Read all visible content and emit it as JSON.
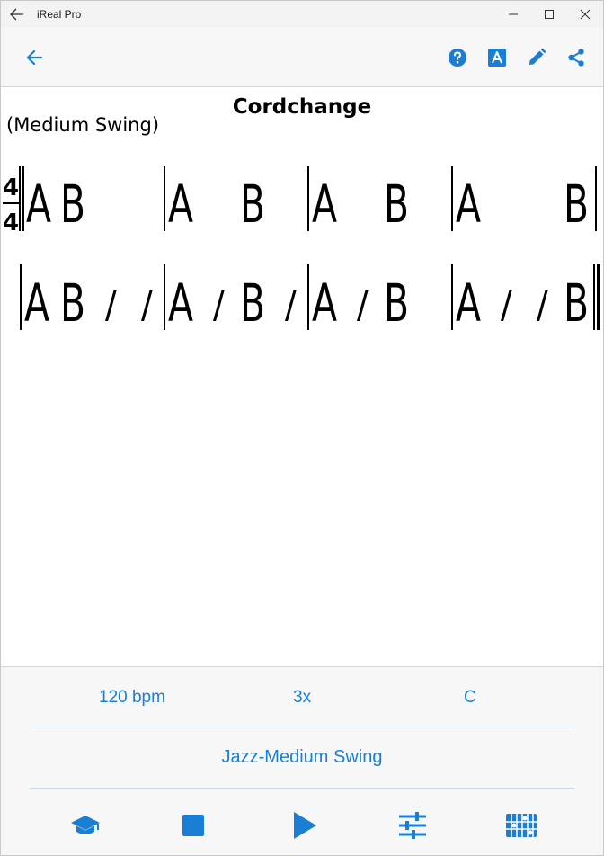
{
  "window": {
    "title": "iReal Pro"
  },
  "song": {
    "title": "Cordchange",
    "style": "(Medium Swing)",
    "time_signature": {
      "top": "4",
      "bottom": "4"
    },
    "chord_a": "A",
    "chord_b": "B",
    "slash": "/"
  },
  "player": {
    "tempo": "120 bpm",
    "repeats": "3x",
    "key": "C",
    "style_preset": "Jazz-Medium Swing"
  },
  "colors": {
    "accent": "#1a7fd4",
    "titlebar": "#f3f3f3",
    "panel": "#f7f7f7"
  },
  "icons": {
    "toolbar": [
      "back-arrow-icon",
      "help-icon",
      "font-icon",
      "edit-pencil-icon",
      "share-icon"
    ],
    "controls": [
      "practice-icon",
      "stop-icon",
      "play-icon",
      "mixer-icon",
      "chord-diagram-icon"
    ]
  }
}
